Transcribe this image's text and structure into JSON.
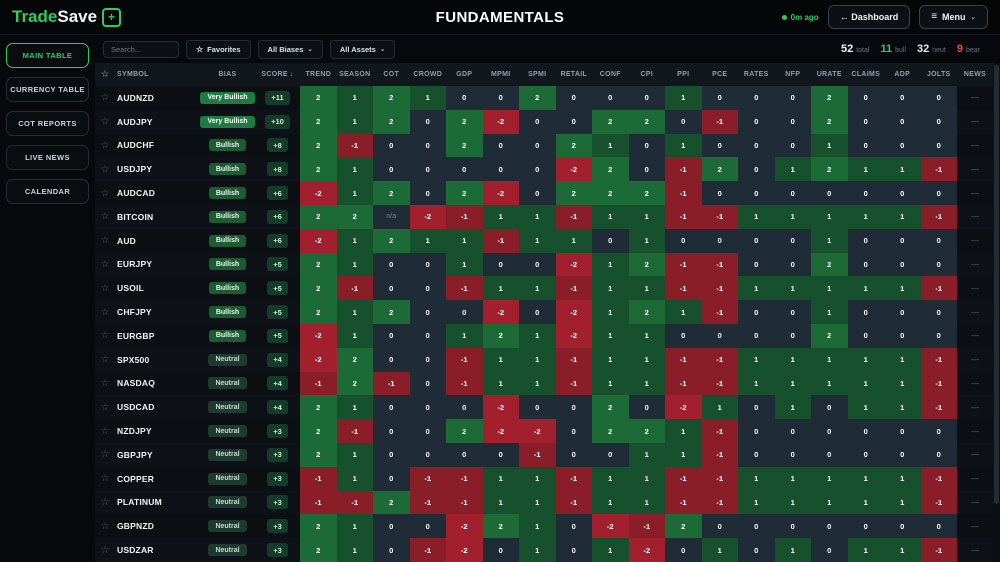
{
  "header": {
    "logo_part1": "Trade",
    "logo_part2": "Save",
    "logo_plus": "+",
    "title": "FUNDAMENTALS",
    "last_update": "0m ago",
    "dashboard_button": "← Dashboard",
    "menu_button": "Menu",
    "menu_icon": "≡",
    "chevron": "⌄"
  },
  "sidebar": {
    "items": [
      {
        "label": "MAIN TABLE",
        "active": true
      },
      {
        "label": "CURRENCY TABLE",
        "active": false
      },
      {
        "label": "COT REPORTS",
        "active": false
      },
      {
        "label": "LIVE NEWS",
        "active": false
      },
      {
        "label": "CALENDAR",
        "active": false
      }
    ]
  },
  "toolbar": {
    "search_placeholder": "Search...",
    "favorites_icon": "☆",
    "favorites_label": "Favorites",
    "bias_filter": "All Biases",
    "asset_filter": "All Assets",
    "chevron": "⌄",
    "stats": [
      {
        "value": "52",
        "label": "total",
        "color": "#f3f4f6"
      },
      {
        "value": "11",
        "label": "bull",
        "color": "#2fcb5f"
      },
      {
        "value": "32",
        "label": "neut",
        "color": "#e5e7eb"
      },
      {
        "value": "9",
        "label": "bear",
        "color": "#e5484d"
      }
    ]
  },
  "table": {
    "star_icon": "☆",
    "symbol_col": "SYMBOL",
    "bias_col": "BIAS",
    "score_col": "SCORE",
    "sort_arrow": "↓",
    "news_col": "NEWS",
    "news_dash": "—",
    "na_text": "n/a",
    "value_columns": [
      "TREND",
      "SEASON",
      "COT",
      "CROWD",
      "GDP",
      "MPMI",
      "SPMI",
      "RETAIL",
      "CONF",
      "CPI",
      "PPI",
      "PCE",
      "RATES",
      "NFP",
      "URATE",
      "CLAIMS",
      "ADP",
      "JOLTS"
    ],
    "rows": [
      {
        "symbol": "AUDNZD",
        "bias": "Very Bullish",
        "score": "+11",
        "values": [
          2,
          1,
          2,
          1,
          0,
          0,
          2,
          0,
          0,
          0,
          1,
          0,
          0,
          0,
          2,
          0,
          0,
          0
        ]
      },
      {
        "symbol": "AUDJPY",
        "bias": "Very Bullish",
        "score": "+10",
        "values": [
          2,
          1,
          2,
          0,
          2,
          -2,
          0,
          0,
          2,
          2,
          0,
          -1,
          0,
          0,
          2,
          0,
          0,
          0
        ]
      },
      {
        "symbol": "AUDCHF",
        "bias": "Bullish",
        "score": "+8",
        "values": [
          2,
          -1,
          0,
          0,
          2,
          0,
          0,
          2,
          1,
          0,
          1,
          0,
          0,
          0,
          1,
          0,
          0,
          0
        ]
      },
      {
        "symbol": "USDJPY",
        "bias": "Bullish",
        "score": "+8",
        "values": [
          2,
          1,
          0,
          0,
          0,
          0,
          0,
          -2,
          2,
          0,
          -1,
          2,
          0,
          1,
          2,
          1,
          1,
          -1
        ]
      },
      {
        "symbol": "AUDCAD",
        "bias": "Bullish",
        "score": "+6",
        "values": [
          -2,
          1,
          2,
          0,
          2,
          -2,
          0,
          2,
          2,
          2,
          -1,
          0,
          0,
          0,
          0,
          0,
          0,
          0
        ]
      },
      {
        "symbol": "BITCOIN",
        "bias": "Bullish",
        "score": "+6",
        "values": [
          2,
          2,
          "n/a",
          -2,
          -1,
          1,
          1,
          -1,
          1,
          1,
          -1,
          -1,
          1,
          1,
          1,
          1,
          1,
          -1
        ]
      },
      {
        "symbol": "AUD",
        "bias": "Bullish",
        "score": "+6",
        "values": [
          -2,
          1,
          2,
          1,
          1,
          -1,
          1,
          1,
          0,
          1,
          0,
          0,
          0,
          0,
          1,
          0,
          0,
          0
        ]
      },
      {
        "symbol": "EURJPY",
        "bias": "Bullish",
        "score": "+5",
        "values": [
          2,
          1,
          0,
          0,
          1,
          0,
          0,
          -2,
          1,
          2,
          -1,
          -1,
          0,
          0,
          2,
          0,
          0,
          0
        ]
      },
      {
        "symbol": "USOIL",
        "bias": "Bullish",
        "score": "+5",
        "values": [
          2,
          -1,
          0,
          0,
          -1,
          1,
          1,
          -1,
          1,
          1,
          -1,
          -1,
          1,
          1,
          1,
          1,
          1,
          -1
        ]
      },
      {
        "symbol": "CHFJPY",
        "bias": "Bullish",
        "score": "+5",
        "values": [
          2,
          1,
          2,
          0,
          0,
          -2,
          0,
          -2,
          1,
          2,
          1,
          -1,
          0,
          0,
          1,
          0,
          0,
          0
        ]
      },
      {
        "symbol": "EURGBP",
        "bias": "Bullish",
        "score": "+5",
        "values": [
          -2,
          1,
          0,
          0,
          1,
          2,
          1,
          -2,
          1,
          1,
          0,
          0,
          0,
          0,
          2,
          0,
          0,
          0
        ]
      },
      {
        "symbol": "SPX500",
        "bias": "Neutral",
        "score": "+4",
        "values": [
          -2,
          2,
          0,
          0,
          -1,
          1,
          1,
          -1,
          1,
          1,
          -1,
          -1,
          1,
          1,
          1,
          1,
          1,
          -1
        ]
      },
      {
        "symbol": "NASDAQ",
        "bias": "Neutral",
        "score": "+4",
        "values": [
          -1,
          2,
          -1,
          0,
          -1,
          1,
          1,
          -1,
          1,
          1,
          -1,
          -1,
          1,
          1,
          1,
          1,
          1,
          -1
        ]
      },
      {
        "symbol": "USDCAD",
        "bias": "Neutral",
        "score": "+4",
        "values": [
          2,
          1,
          0,
          0,
          0,
          -2,
          0,
          0,
          2,
          0,
          -2,
          1,
          0,
          1,
          0,
          1,
          1,
          -1
        ]
      },
      {
        "symbol": "NZDJPY",
        "bias": "Neutral",
        "score": "+3",
        "values": [
          2,
          -1,
          0,
          0,
          2,
          -2,
          -2,
          0,
          2,
          2,
          1,
          -1,
          0,
          0,
          0,
          0,
          0,
          0
        ]
      },
      {
        "symbol": "GBPJPY",
        "bias": "Neutral",
        "score": "+3",
        "values": [
          2,
          1,
          0,
          0,
          0,
          0,
          -1,
          0,
          0,
          1,
          1,
          -1,
          0,
          0,
          0,
          0,
          0,
          0
        ]
      },
      {
        "symbol": "COPPER",
        "bias": "Neutral",
        "score": "+3",
        "values": [
          -1,
          1,
          0,
          -1,
          -1,
          1,
          1,
          -1,
          1,
          1,
          -1,
          -1,
          1,
          1,
          1,
          1,
          1,
          -1
        ]
      },
      {
        "symbol": "PLATINUM",
        "bias": "Neutral",
        "score": "+3",
        "values": [
          -1,
          -1,
          2,
          -1,
          -1,
          1,
          1,
          -1,
          1,
          1,
          -1,
          -1,
          1,
          1,
          1,
          1,
          1,
          -1
        ]
      },
      {
        "symbol": "GBPNZD",
        "bias": "Neutral",
        "score": "+3",
        "values": [
          2,
          1,
          0,
          0,
          -2,
          2,
          1,
          0,
          -2,
          -1,
          2,
          0,
          0,
          0,
          0,
          0,
          0,
          0
        ]
      },
      {
        "symbol": "USDZAR",
        "bias": "Neutral",
        "score": "+3",
        "values": [
          2,
          1,
          0,
          -1,
          -2,
          0,
          1,
          0,
          1,
          -2,
          0,
          1,
          0,
          1,
          0,
          1,
          1,
          -1
        ]
      }
    ]
  },
  "colors": {
    "accent_green": "#2fcb5f",
    "accent_red": "#e5484d",
    "cells": {
      "2": "#1c6b37",
      "1": "#17502c",
      "0": "#202b38",
      "-1": "#8a1e28",
      "-2": "#a21f2e",
      "na": "#202b38"
    }
  }
}
